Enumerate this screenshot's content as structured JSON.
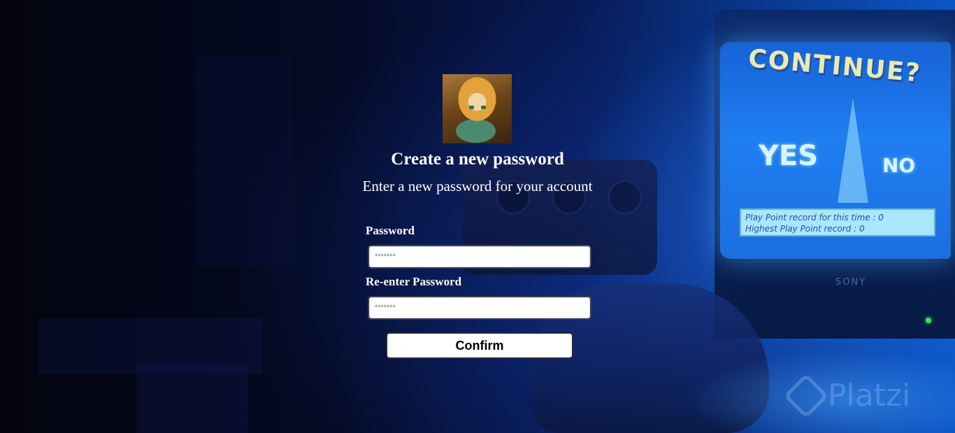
{
  "form": {
    "title": "Create a new password",
    "subtitle": "Enter a new password for your account",
    "password": {
      "label": "Password",
      "placeholder": "*******",
      "value": ""
    },
    "reenter_password": {
      "label": "Re-enter Password",
      "placeholder": "*******",
      "value": ""
    },
    "confirm_label": "Confirm"
  },
  "background": {
    "tv_title": "CONTINUE?",
    "tv_yes": "YES",
    "tv_no": "NO",
    "tv_record_line1": "Play Point record for this time :   0",
    "tv_record_line2": "Highest Play Point record         :   0",
    "tv_brand": "SONY",
    "watermark": "Platzi"
  },
  "colors": {
    "text": "#ffffff",
    "input_bg": "#ffffff",
    "button_bg": "#ffffff",
    "bg_dark": "#04071a",
    "bg_glow": "#0c57c8"
  }
}
